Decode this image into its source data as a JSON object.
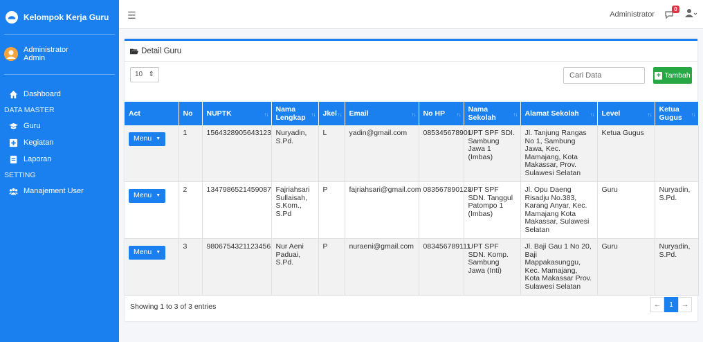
{
  "app": {
    "title": "Kelompok Kerja Guru"
  },
  "user": {
    "line1": "Administrator",
    "line2": "Admin"
  },
  "sidebar": {
    "items": [
      {
        "type": "item",
        "label": "Dashboard",
        "icon": "home-icon"
      },
      {
        "type": "header",
        "label": "DATA MASTER"
      },
      {
        "type": "item",
        "label": "Guru",
        "icon": "graduation-cap-icon"
      },
      {
        "type": "item",
        "label": "Kegiatan",
        "icon": "plus-square-icon"
      },
      {
        "type": "item",
        "label": "Laporan",
        "icon": "document-icon"
      },
      {
        "type": "header",
        "label": "SETTING"
      },
      {
        "type": "item",
        "label": "Manajement User",
        "icon": "users-icon"
      }
    ]
  },
  "topbar": {
    "user_label": "Administrator",
    "notif_count": "0"
  },
  "card": {
    "title": "Detail Guru"
  },
  "controls": {
    "page_length": "10",
    "search_placeholder": "Cari Data",
    "add_label": "Tambah"
  },
  "table": {
    "headers": [
      "Act",
      "No",
      "NUPTK",
      "Nama Lengkap",
      "Jkel",
      "Email",
      "No HP",
      "Nama Sekolah",
      "Alamat Sekolah",
      "Level",
      "Ketua Gugus"
    ],
    "menu_label": "Menu",
    "rows": [
      {
        "no": "1",
        "nuptk": "1564328905643123",
        "nama": "Nuryadin, S.Pd.",
        "jkel": "L",
        "email": "yadin@gmail.com",
        "hp": "085345678901",
        "sekolah": "UPT SPF SDI. Sambung Jawa 1 (Imbas)",
        "alamat": "Jl. Tanjung Rangas No 1, Sambung Jawa, Kec. Mamajang, Kota Makassar, Prov. Sulawesi Selatan",
        "level": "Ketua Gugus",
        "ketua": ""
      },
      {
        "no": "2",
        "nuptk": "1347986521459087",
        "nama": "Fajriahsari Sullaisah, S.Kom., S.Pd",
        "jkel": "P",
        "email": "fajriahsari@gmail.com",
        "hp": "083567890123",
        "sekolah": "UPT SPF SDN. Tanggul Patompo 1 (Imbas)",
        "alamat": "Jl. Opu Daeng Risadju No.383, Karang Anyar, Kec. Mamajang Kota Makassar, Sulawesi Selatan",
        "level": "Guru",
        "ketua": "Nuryadin, S.Pd."
      },
      {
        "no": "3",
        "nuptk": "9806754321123456",
        "nama": "Nur Aeni Paduai, S.Pd.",
        "jkel": "P",
        "email": "nuraeni@gmail.com",
        "hp": "083456789111",
        "sekolah": "UPT SPF SDN. Komp. Sambung Jawa (Inti)",
        "alamat": "Jl. Baji Gau 1 No 20, Baji Mappakasunggu, Kec. Mamajang, Kota Makassar Prov. Sulawesi Selatan",
        "level": "Guru",
        "ketua": "Nuryadin, S.Pd."
      }
    ]
  },
  "footer": {
    "info": "Showing 1 to 3 of 3 entries",
    "prev": "←",
    "page": "1",
    "next": "→"
  },
  "colors": {
    "primary": "#1a80f0",
    "success": "#28a745",
    "danger": "#dc3545"
  }
}
